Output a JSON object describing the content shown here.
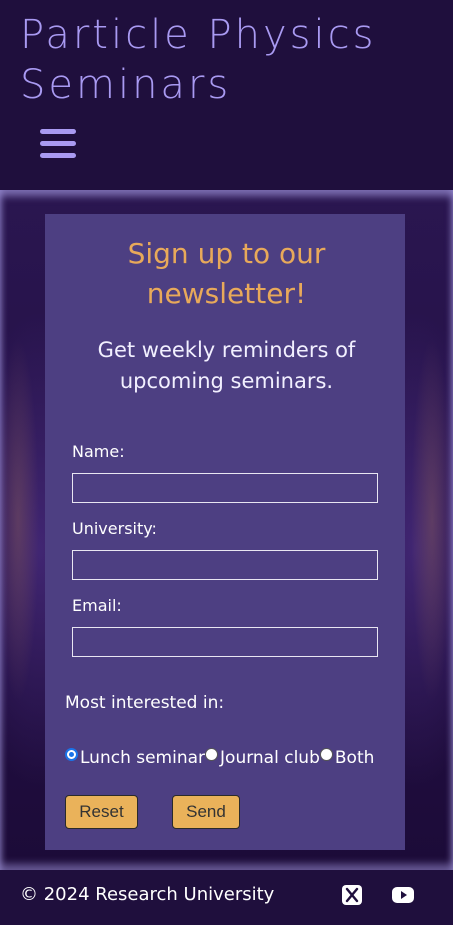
{
  "header": {
    "title_line1": "Particle Physics",
    "title_line2": "Seminars",
    "menu_icon": "hamburger-menu-icon"
  },
  "signup": {
    "title_line1": "Sign up to our",
    "title_line2": "newsletter!",
    "subtitle_line1": "Get weekly reminders of",
    "subtitle_line2": "upcoming seminars.",
    "fields": {
      "name_label": "Name:",
      "name_value": "",
      "university_label": "University:",
      "university_value": "",
      "email_label": "Email:",
      "email_value": ""
    },
    "interest_label": "Most interested in:",
    "options": [
      "Lunch seminar",
      "Journal club",
      "Both"
    ],
    "selected_option": "Lunch seminar",
    "reset_label": "Reset",
    "send_label": "Send"
  },
  "footer": {
    "copyright": "© 2024 Research University",
    "social_icons": [
      "x-twitter-icon",
      "youtube-icon"
    ]
  },
  "colors": {
    "background": "#1f0f3d",
    "title": "#a99af2",
    "card": "#4d3f82",
    "heading_accent": "#e8a95a",
    "button": "#eab25a"
  }
}
